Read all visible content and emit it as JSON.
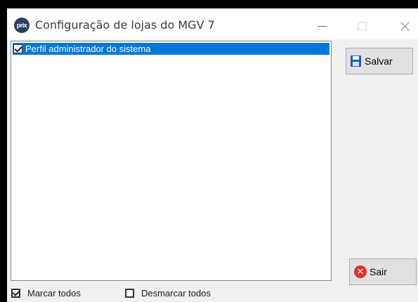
{
  "window": {
    "title": "Configuração de lojas do MGV 7",
    "icon_label": "prix",
    "icon_color": "#2c3e67"
  },
  "list": {
    "items": [
      {
        "label": "Perfil administrador do sistema",
        "checked": true,
        "selected": true
      }
    ],
    "selection_color": "#0078d7"
  },
  "buttons": {
    "save_label": "Salvar",
    "exit_label": "Sair",
    "save_icon": "floppy-disk-icon",
    "exit_icon": "red-x-circle-icon"
  },
  "footer": {
    "mark_all_label": "Marcar todos",
    "mark_all_checked": true,
    "unmark_all_label": "Desmarcar todos",
    "unmark_all_checked": false
  }
}
